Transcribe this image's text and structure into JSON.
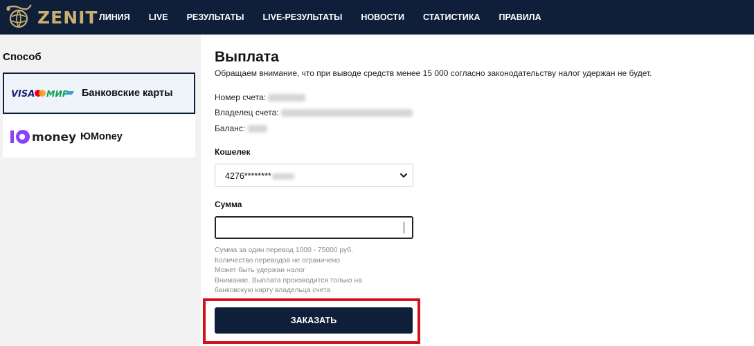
{
  "header": {
    "logo_text": "ZENIT",
    "nav": [
      "ЛИНИЯ",
      "LIVE",
      "РЕЗУЛЬТАТЫ",
      "LIVE-РЕЗУЛЬТАТЫ",
      "НОВОСТИ",
      "СТАТИСТИКА",
      "ПРАВИЛА"
    ]
  },
  "sidebar": {
    "title": "Способ",
    "methods": [
      {
        "label": "Банковские карты",
        "logo": "visa-mastercard-mir-logo",
        "selected": true
      },
      {
        "label": "ЮMoney",
        "logo_text": "money",
        "logo": "yoomoney-logo",
        "selected": false
      }
    ]
  },
  "main": {
    "title": "Выплата",
    "notice": "Обращаем внимание, что при выводе средств менее 15 000 согласно законодательству налог удержан не будет.",
    "account_label": "Номер счета:",
    "owner_label": "Владелец счета:",
    "balance_label": "Баланс:",
    "wallet_label": "Кошелек",
    "wallet_value": "4276********",
    "amount_label": "Сумма",
    "amount_value": "",
    "hints": [
      "Сумма за один перевод 1000 - 75000 руб.",
      "Количество переводов не ограничено",
      "Может быть удержан налог",
      "Внимание. Выплата производится только на банковскую карту владельца счета"
    ],
    "order_button": "ЗАКАЗАТЬ"
  },
  "colors": {
    "header_bg": "#0f1f3a",
    "logo_gold": "#c9b072",
    "highlight_red": "#d3131b",
    "visa_blue": "#1a1f71",
    "mir_green": "#0f9f4f",
    "yoomoney_purple": "#8b3ffd"
  }
}
